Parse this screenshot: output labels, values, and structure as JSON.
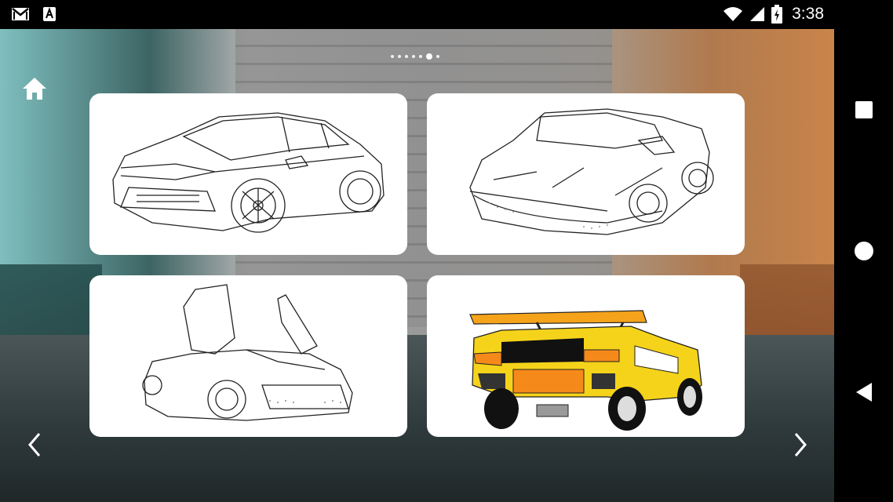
{
  "status_bar": {
    "time": "3:38",
    "icons": [
      "gmail-icon",
      "app-a-icon",
      "wifi-icon",
      "signal-icon",
      "battery-icon"
    ]
  },
  "app": {
    "page_indicator": {
      "total": 7,
      "active_index": 5
    },
    "home_icon": "home-icon",
    "cards": [
      {
        "name": "car-card-suv",
        "color_hint": "line-art"
      },
      {
        "name": "car-card-convertible",
        "color_hint": "line-art"
      },
      {
        "name": "car-card-scissor-doors",
        "color_hint": "line-art"
      },
      {
        "name": "car-card-yellow-supercar",
        "color_hint": "#f5d31a"
      }
    ],
    "prev_icon": "chevron-left-icon",
    "next_icon": "chevron-right-icon"
  },
  "nav_bar": {
    "buttons": [
      "recents-square-icon",
      "home-circle-icon",
      "back-triangle-icon"
    ]
  }
}
